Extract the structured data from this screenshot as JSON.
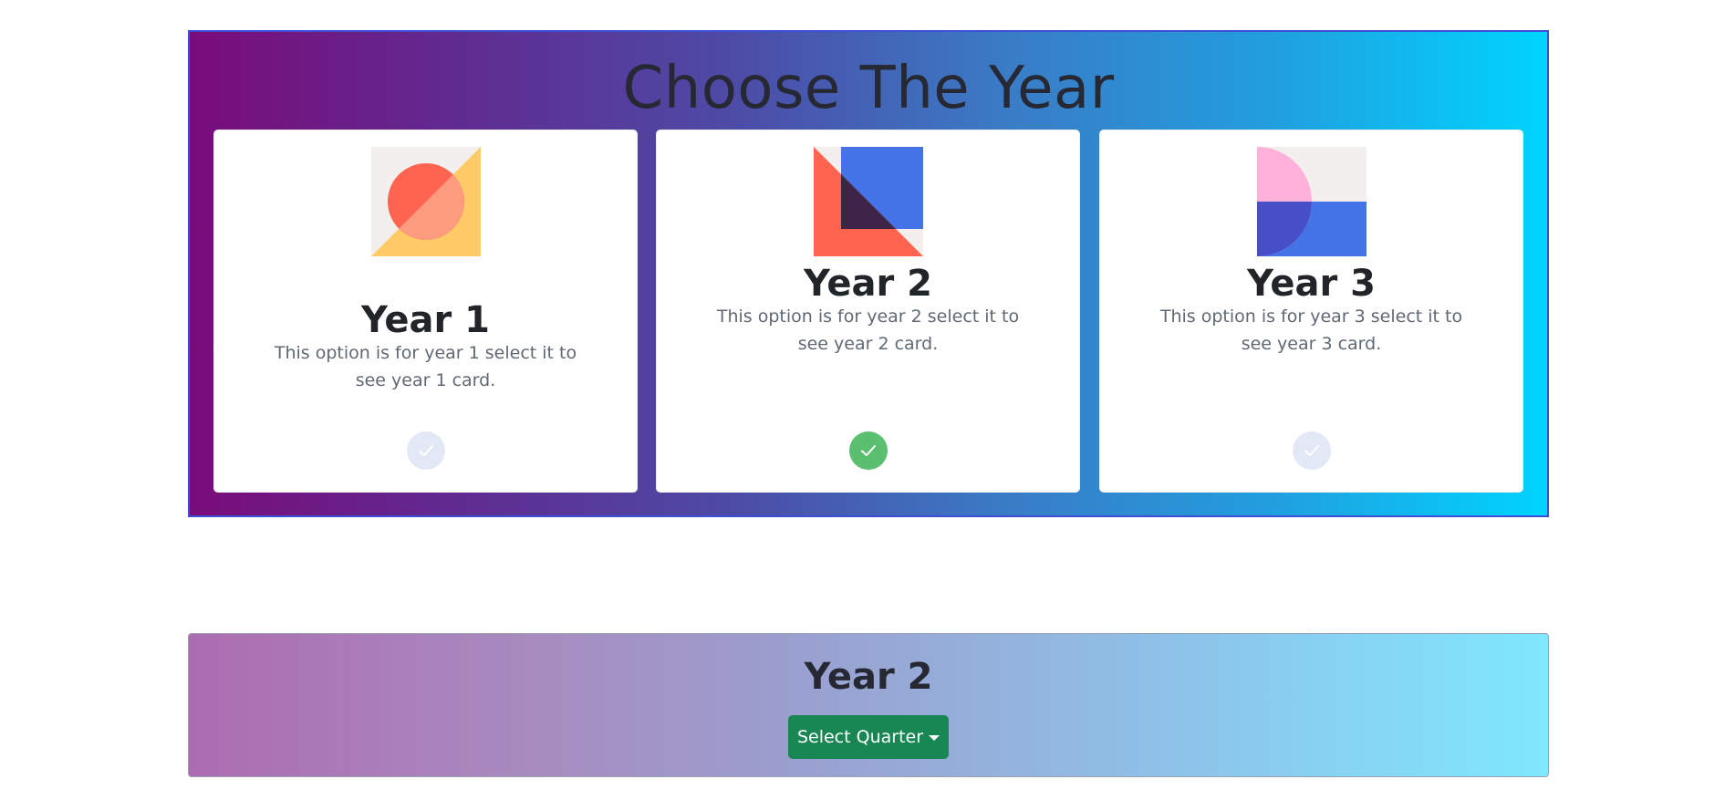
{
  "chooser": {
    "title": "Choose The Year",
    "cards": [
      {
        "title": "Year 1",
        "text": "This option is for year 1 select it to see year 1 card.",
        "selected": false,
        "art_icon": "circle-triangle-art-icon"
      },
      {
        "title": "Year 2",
        "text": "This option is for year 2 select it to see year 2 card.",
        "selected": true,
        "art_icon": "square-triangle-art-icon"
      },
      {
        "title": "Year 3",
        "text": "This option is for year 3 select it to see year 3 card.",
        "selected": false,
        "art_icon": "halfcircle-rectangle-art-icon"
      }
    ]
  },
  "year_panel": {
    "title": "Year 2",
    "select_quarter_label": "Select Quarter"
  },
  "colors": {
    "selected_check": "#5bbf70",
    "unselected_check": "#e2e8f5",
    "quarter_button": "#198754",
    "chooser_gradient_start": "#790c7a",
    "chooser_gradient_end": "#00d4ff"
  }
}
